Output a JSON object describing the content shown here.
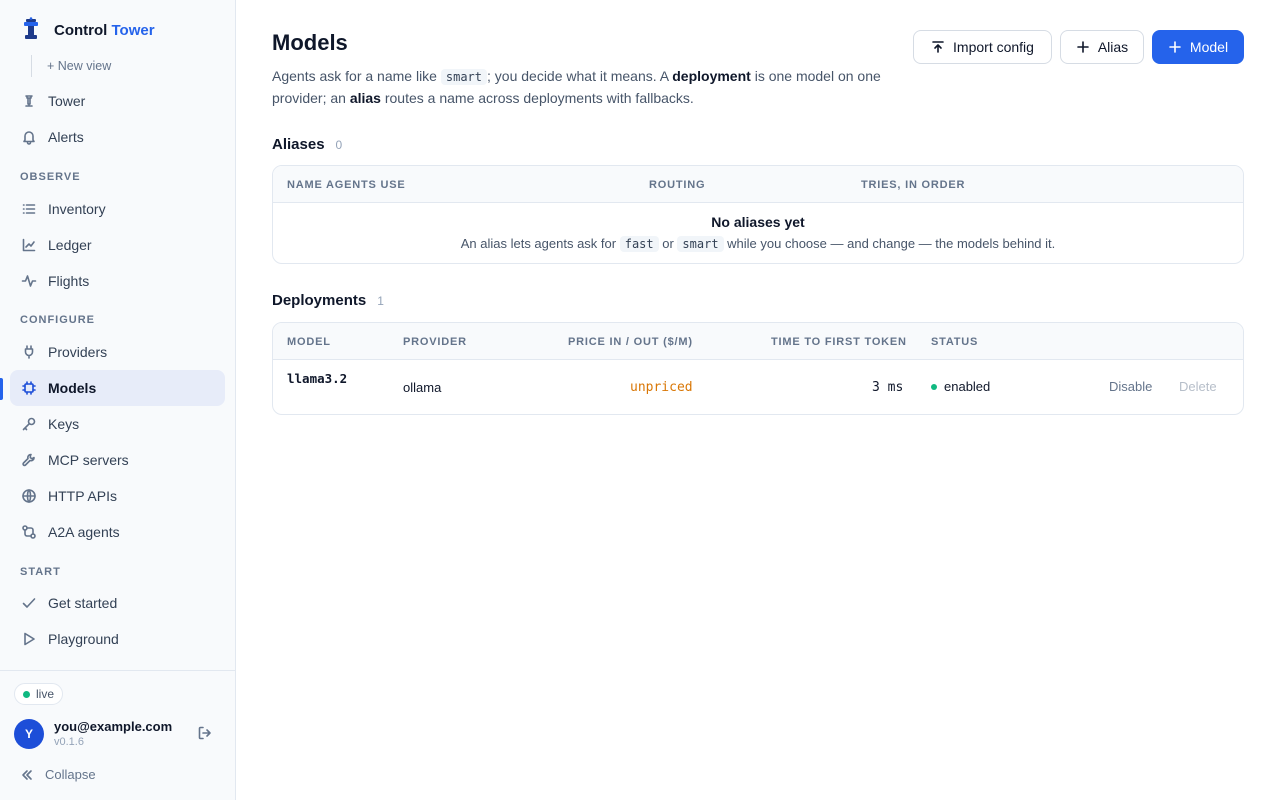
{
  "app": {
    "brand_primary": "Control",
    "brand_accent": "Tower",
    "accent_color": "#2563eb"
  },
  "sidebar": {
    "new_view": "+ New view",
    "top_items": [
      {
        "label": "Tower",
        "icon": "tower-icon"
      },
      {
        "label": "Alerts",
        "icon": "bell-icon"
      }
    ],
    "sections": {
      "observe": "OBSERVE",
      "configure": "CONFIGURE",
      "start": "START"
    },
    "observe_items": [
      {
        "label": "Inventory",
        "icon": "list-icon"
      },
      {
        "label": "Ledger",
        "icon": "line-chart-icon"
      },
      {
        "label": "Flights",
        "icon": "activity-icon"
      }
    ],
    "configure_items": [
      {
        "label": "Providers",
        "icon": "plug-icon"
      },
      {
        "label": "Models",
        "icon": "cpu-icon",
        "active": true
      },
      {
        "label": "Keys",
        "icon": "key-icon"
      },
      {
        "label": "MCP servers",
        "icon": "wrench-icon"
      },
      {
        "label": "HTTP APIs",
        "icon": "globe-icon"
      },
      {
        "label": "A2A agents",
        "icon": "agents-icon"
      }
    ],
    "start_items": [
      {
        "label": "Get started",
        "icon": "check-icon"
      },
      {
        "label": "Playground",
        "icon": "play-icon"
      }
    ],
    "footer": {
      "status": "live",
      "avatar_letter": "Y",
      "email": "you@example.com",
      "version": "v0.1.6",
      "collapse": "Collapse"
    }
  },
  "header": {
    "title": "Models",
    "desc": {
      "p1": "Agents ask for a name like ",
      "code1": "smart",
      "p2": "; you decide what it means. A ",
      "b1": "deployment",
      "p3": " is one model on one provider; an ",
      "b2": "alias",
      "p4": " routes a name across deployments with fallbacks."
    },
    "buttons": {
      "import": "Import config",
      "alias": "Alias",
      "model": "Model"
    }
  },
  "aliases": {
    "title": "Aliases",
    "count": "0",
    "columns": [
      "NAME AGENTS USE",
      "ROUTING",
      "TRIES, IN ORDER"
    ],
    "empty_title": "No aliases yet",
    "empty_desc": {
      "p1": "An alias lets agents ask for ",
      "code1": "fast",
      "p2": " or ",
      "code2": "smart",
      "p3": " while you choose — and change — the models behind it."
    }
  },
  "deployments": {
    "title": "Deployments",
    "count": "1",
    "columns": [
      "MODEL",
      "PROVIDER",
      "PRICE IN / OUT ($/M)",
      "TIME TO FIRST TOKEN",
      "STATUS"
    ],
    "rows": [
      {
        "model": "llama3.2",
        "provider": "ollama",
        "price": "unpriced",
        "ttft": "3 ms",
        "status": "enabled",
        "status_color": "#10b981",
        "actions": {
          "disable": "Disable",
          "delete": "Delete"
        }
      }
    ]
  }
}
